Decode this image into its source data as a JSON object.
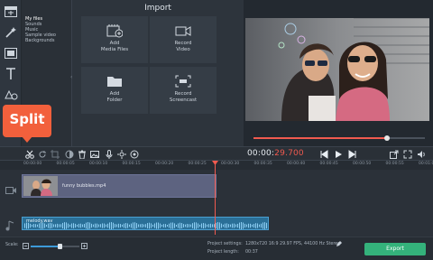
{
  "tool_rail": {
    "tools": [
      "import-icon",
      "magic-wand-icon",
      "filters-icon",
      "titles-icon",
      "transitions-icon"
    ]
  },
  "media_tree": {
    "items": [
      "My files",
      "Sounds",
      "Music",
      "Sample video",
      "Backgrounds"
    ]
  },
  "import_panel": {
    "title": "Import",
    "tiles": [
      {
        "label": "Add\nMedia Files",
        "icon": "add-media-icon"
      },
      {
        "label": "Record\nVideo",
        "icon": "video-camera-icon"
      },
      {
        "label": "Add\nFolder",
        "icon": "folder-icon"
      },
      {
        "label": "Record\nScreencast",
        "icon": "screencast-icon"
      }
    ]
  },
  "callout": {
    "label": "Split"
  },
  "player": {
    "timecode_main": "00:00:",
    "timecode_ms": "29.700",
    "progress": 0.78
  },
  "ruler": {
    "ticks": [
      "00:00:00",
      "00:00:05",
      "00:00:10",
      "00:00:15",
      "00:00:20",
      "00:00:25",
      "00:00:30",
      "00:00:35",
      "00:00:40",
      "00:00:45",
      "00:00:50",
      "00:00:55",
      "00:01:00"
    ]
  },
  "tracks": {
    "video_clip": "funny bubbles.mp4",
    "audio_clip": "melody.wav"
  },
  "status_bar": {
    "scale_label": "Scale:",
    "zoom_level": 0.6,
    "project_settings_label": "Project settings:",
    "project_settings_value": "1280x720 16:9 29.97 FPS, 44100 Hz Stereo",
    "project_length_label": "Project length:",
    "project_length_value": "00:37",
    "export_label": "Export"
  },
  "colors": {
    "accent_red": "#f05a4f",
    "callout_orange": "#f2603c",
    "audio_blue": "#2a6f97",
    "export_green": "#34b27b"
  }
}
